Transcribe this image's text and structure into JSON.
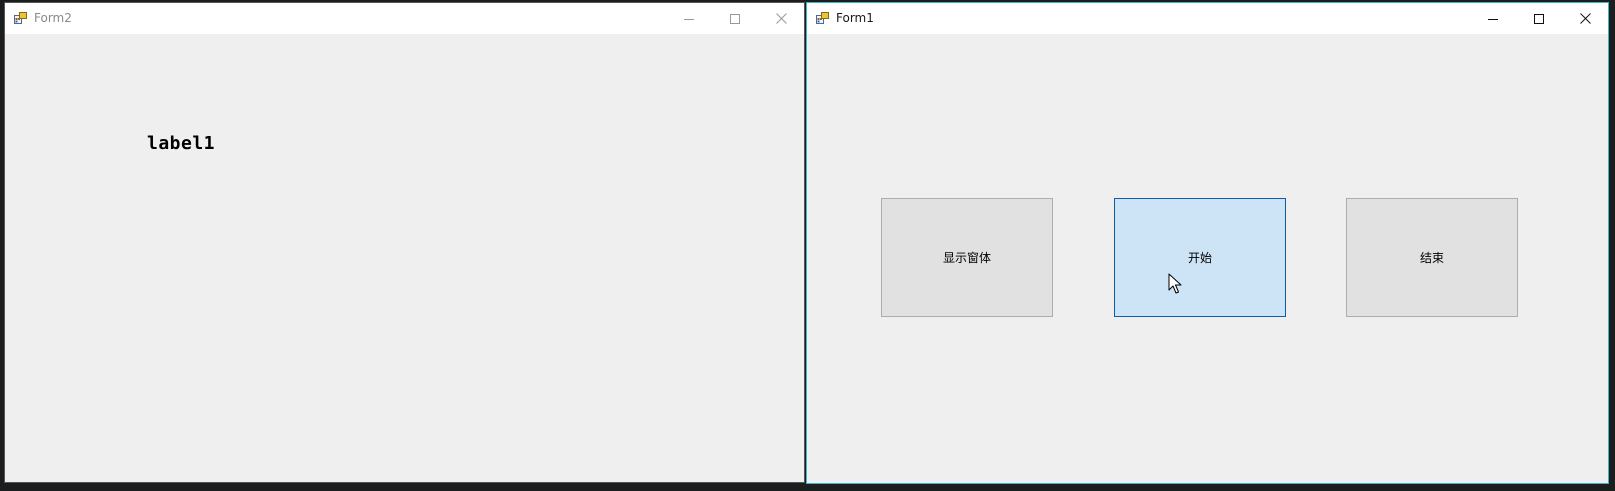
{
  "form2": {
    "title": "Form2",
    "label": "label1"
  },
  "form1": {
    "title": "Form1",
    "buttons": {
      "show_form": "显示窗体",
      "start": "开始",
      "end": "结束"
    }
  },
  "colors": {
    "button_hover_bg": "#cde4f7",
    "button_hover_border": "#0c5ea8",
    "active_window_border": "#39b6c9"
  },
  "icons": [
    "app-icon",
    "minimize-icon",
    "maximize-icon",
    "close-icon",
    "mouse-cursor-icon"
  ]
}
